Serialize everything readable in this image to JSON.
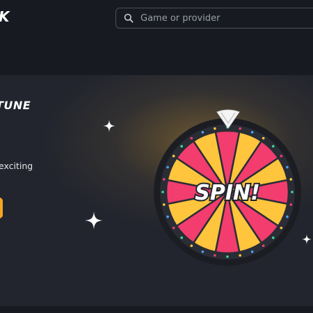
{
  "header": {
    "logo_fragment": "K",
    "search": {
      "placeholder": "Game or provider",
      "value": ""
    }
  },
  "hero": {
    "title_fragment": "TUNE",
    "description_fragment": "exciting",
    "wheel": {
      "button_label": "SPIN!",
      "segment_count": 16
    }
  },
  "colors": {
    "wheel_pink": "#f23d6e",
    "wheel_yellow": "#ffc53d",
    "wheel_rim": "#1b1d23",
    "cta_orange": "#f5a623",
    "background": "#1c1f27"
  },
  "icons": [
    "search-icon",
    "wheel-pointer-icon",
    "sparkle-icon"
  ]
}
